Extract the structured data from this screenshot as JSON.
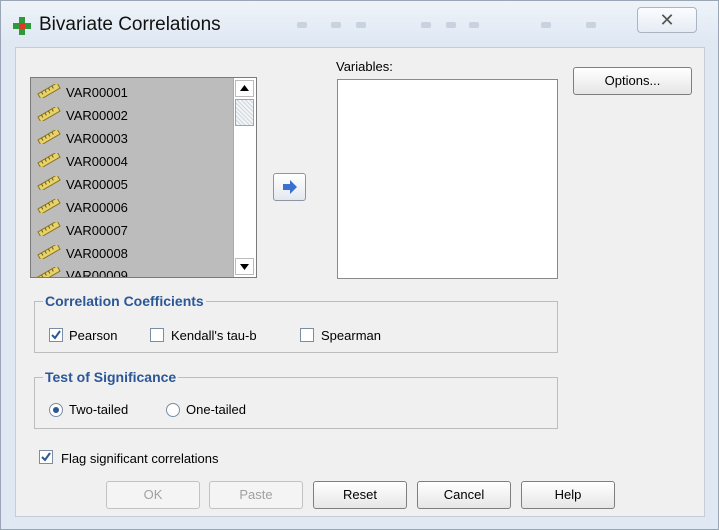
{
  "window": {
    "title": "Bivariate Correlations",
    "close_glyph": "✕"
  },
  "source_list": {
    "items": [
      "VAR00001",
      "VAR00002",
      "VAR00003",
      "VAR00004",
      "VAR00005",
      "VAR00006",
      "VAR00007",
      "VAR00008",
      "VAR00009"
    ],
    "item_icon": "ruler-icon"
  },
  "move_button": {
    "icon": "right-arrow-icon"
  },
  "variables": {
    "label": "Variables:",
    "items": []
  },
  "buttons": {
    "options": "Options...",
    "ok": "OK",
    "paste": "Paste",
    "reset": "Reset",
    "cancel": "Cancel",
    "help": "Help"
  },
  "correlation_coefficients": {
    "title": "Correlation Coefficients",
    "pearson": {
      "label": "Pearson",
      "checked": true
    },
    "kendall": {
      "label": "Kendall's tau-b",
      "checked": false
    },
    "spearman": {
      "label": "Spearman",
      "checked": false
    }
  },
  "test_of_significance": {
    "title": "Test of Significance",
    "two_tailed": {
      "label": "Two-tailed",
      "selected": true
    },
    "one_tailed": {
      "label": "One-tailed",
      "selected": false
    }
  },
  "flag_significant": {
    "label": "Flag significant correlations",
    "checked": true
  },
  "colors": {
    "group_title": "#2b5797",
    "list_bg": "#bcbcbc",
    "check_mark": "#2b5797"
  }
}
